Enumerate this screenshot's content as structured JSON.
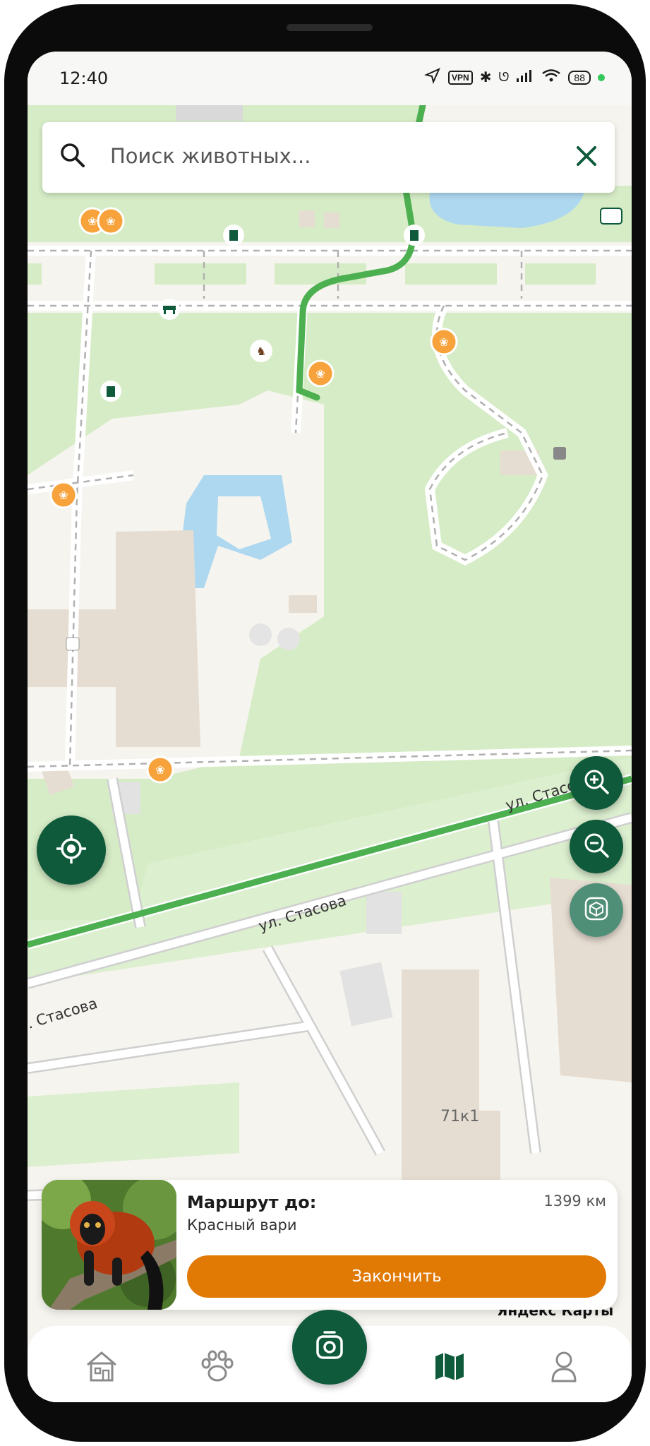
{
  "status_bar": {
    "time": "12:40",
    "vpn": "VPN",
    "battery": "88"
  },
  "search": {
    "placeholder": "Поиск животных..."
  },
  "map": {
    "street_labels": [
      "ул. Стасова",
      "ул. Стасова",
      ". Стасова"
    ],
    "building_label": "71к1",
    "attribution": "Яндекс Карты"
  },
  "route_card": {
    "title": "Маршрут до:",
    "animal": "Красный вари",
    "distance": "1399 км",
    "finish_label": "Закончить"
  },
  "nav": {
    "items": [
      {
        "icon": "home-icon"
      },
      {
        "icon": "paw-icon"
      },
      {
        "icon": "camera-icon"
      },
      {
        "icon": "map-icon"
      },
      {
        "icon": "profile-icon"
      }
    ]
  },
  "colors": {
    "primary": "#0e5a3b",
    "accent": "#e07a05",
    "route": "#4caf50",
    "park": "#d4ecc4",
    "water": "#aed8f0"
  }
}
